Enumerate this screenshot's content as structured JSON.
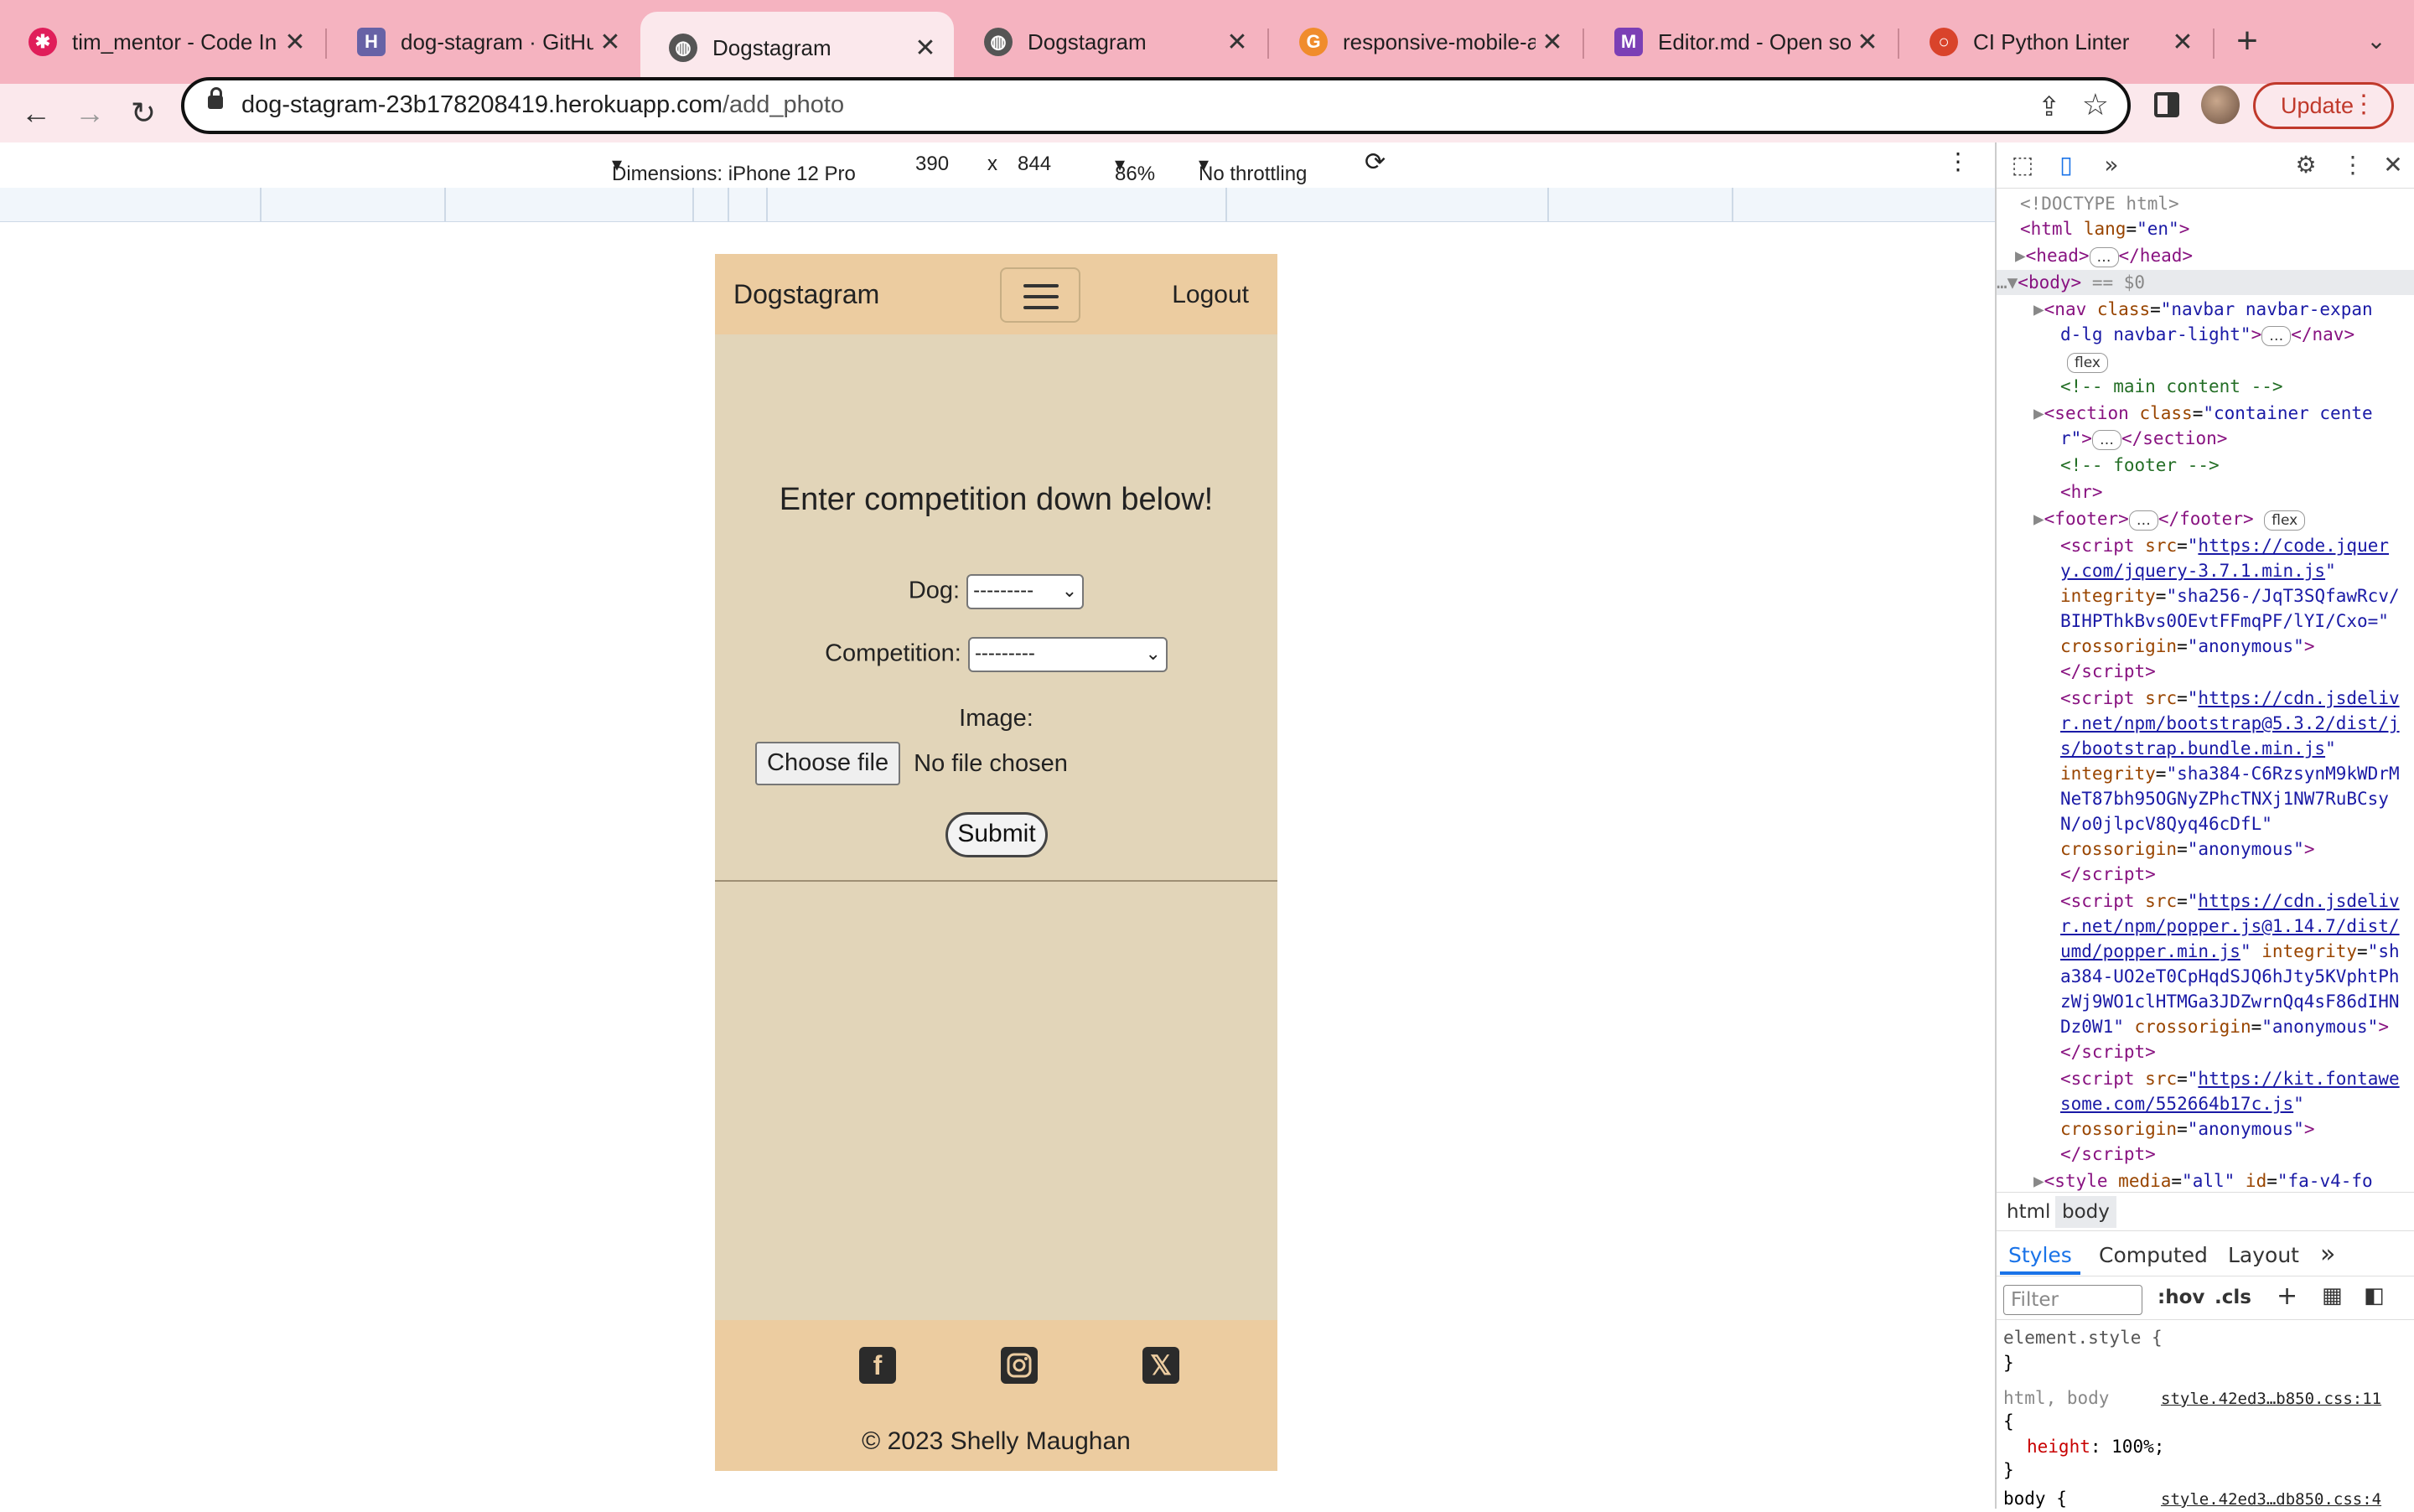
{
  "tabs": [
    {
      "title": "tim_mentor - Code In",
      "favicon": "slack-icon",
      "color": "#e01e5a"
    },
    {
      "title": "dog-stagram · GitHub",
      "favicon": "heroku-icon",
      "color": "#6762a6"
    },
    {
      "title": "Dogstagram",
      "favicon": "globe-icon",
      "color": "#555555",
      "active": true
    },
    {
      "title": "Dogstagram",
      "favicon": "globe-icon",
      "color": "#555555"
    },
    {
      "title": "responsive-mobile-a",
      "favicon": "g-icon",
      "color": "#f08c2c"
    },
    {
      "title": "Editor.md - Open sou",
      "favicon": "m-icon",
      "color": "#7b3fb5"
    },
    {
      "title": "CI Python Linter",
      "favicon": "ci-icon",
      "color": "#d9432b"
    }
  ],
  "address": {
    "host": "dog-stagram-23b178208419.herokuapp.com",
    "path": "/add_photo"
  },
  "update_label": "Update",
  "device_toolbar": {
    "dimensions": "Dimensions: iPhone 12 Pro",
    "width": "390",
    "times": "x",
    "height": "844",
    "zoom": "86%",
    "throttle": "No throttling"
  },
  "site": {
    "brand": "Dogstagram",
    "logout": "Logout",
    "heading": "Enter competition down below!",
    "dog_label": "Dog:",
    "dog_value": "---------",
    "competition_label": "Competition:",
    "competition_value": "---------",
    "image_label": "Image:",
    "choose_file": "Choose file",
    "no_file": "No file chosen",
    "submit": "Submit",
    "copyright": "© 2023 Shelly Maughan"
  },
  "devtools": {
    "crumbs": [
      "html",
      "body"
    ],
    "style_tabs": [
      "Styles",
      "Computed",
      "Layout"
    ],
    "filter_placeholder": "Filter",
    "hov": ":hov",
    "cls": ".cls",
    "element_style": "element.style {",
    "close_brace": "}",
    "rule1_selector": "html, body",
    "rule1_source": "style.42ed3…b850.css:11",
    "rule1_prop": "height",
    "rule1_val": "100%;",
    "rule2_selector": "body {",
    "rule2_source": "style.42ed3…db850.css:4"
  }
}
